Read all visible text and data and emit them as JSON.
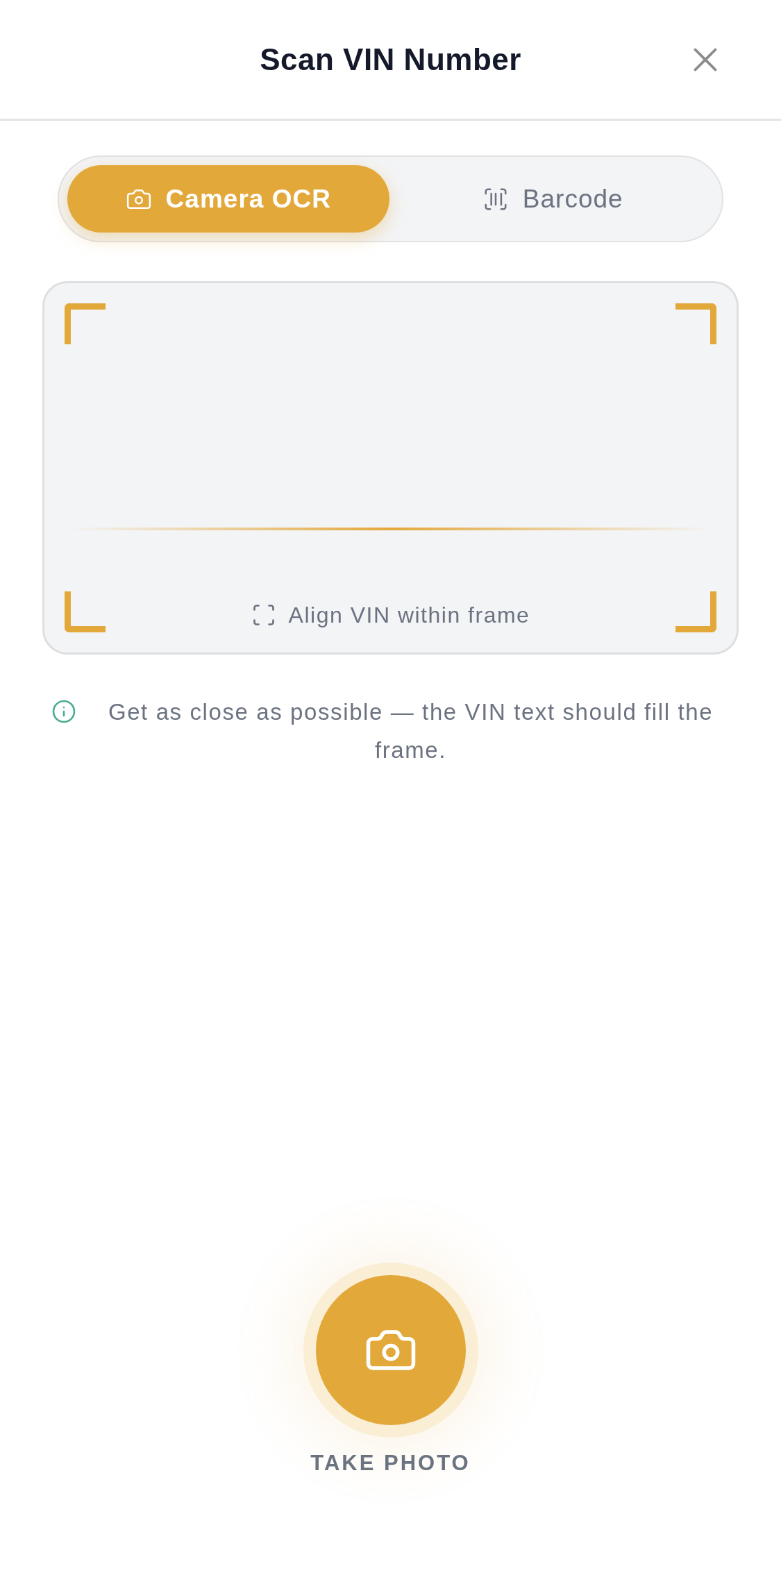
{
  "header": {
    "title": "Scan VIN Number"
  },
  "mode_tabs": [
    {
      "label": "Camera OCR",
      "kind": "camera",
      "selected": true
    },
    {
      "label": "Barcode",
      "kind": "barcode",
      "selected": false
    }
  ],
  "scan_frame": {
    "hint": "Align VIN within frame"
  },
  "tip": {
    "text": "Get as close as possible — the VIN text should fill the frame."
  },
  "capture_button": {
    "label": "TAKE PHOTO"
  }
}
